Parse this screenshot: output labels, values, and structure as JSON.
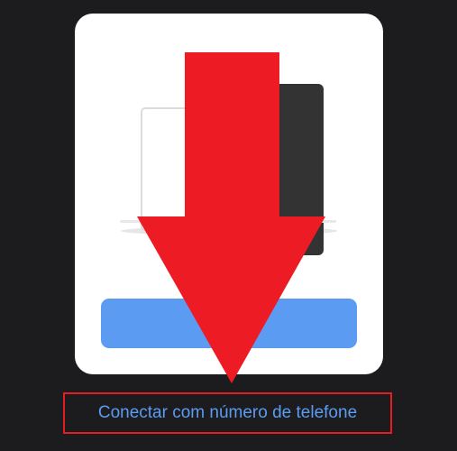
{
  "screen": {
    "background_color": "#1c1c1e",
    "card_color": "#ffffff"
  },
  "illustration": {
    "icon": "devices-illustration-icon",
    "light_device_color": "#ffffff",
    "dark_device_color": "#333333"
  },
  "primary_button": {
    "label": "",
    "color": "#5b9cf2"
  },
  "phone_link": {
    "label": "Conectar com número de telefone",
    "color": "#5b9cf2"
  },
  "annotation": {
    "arrow_icon": "down-arrow-icon",
    "arrow_color": "#ed1c24",
    "highlight_box_color": "#e51d23"
  }
}
